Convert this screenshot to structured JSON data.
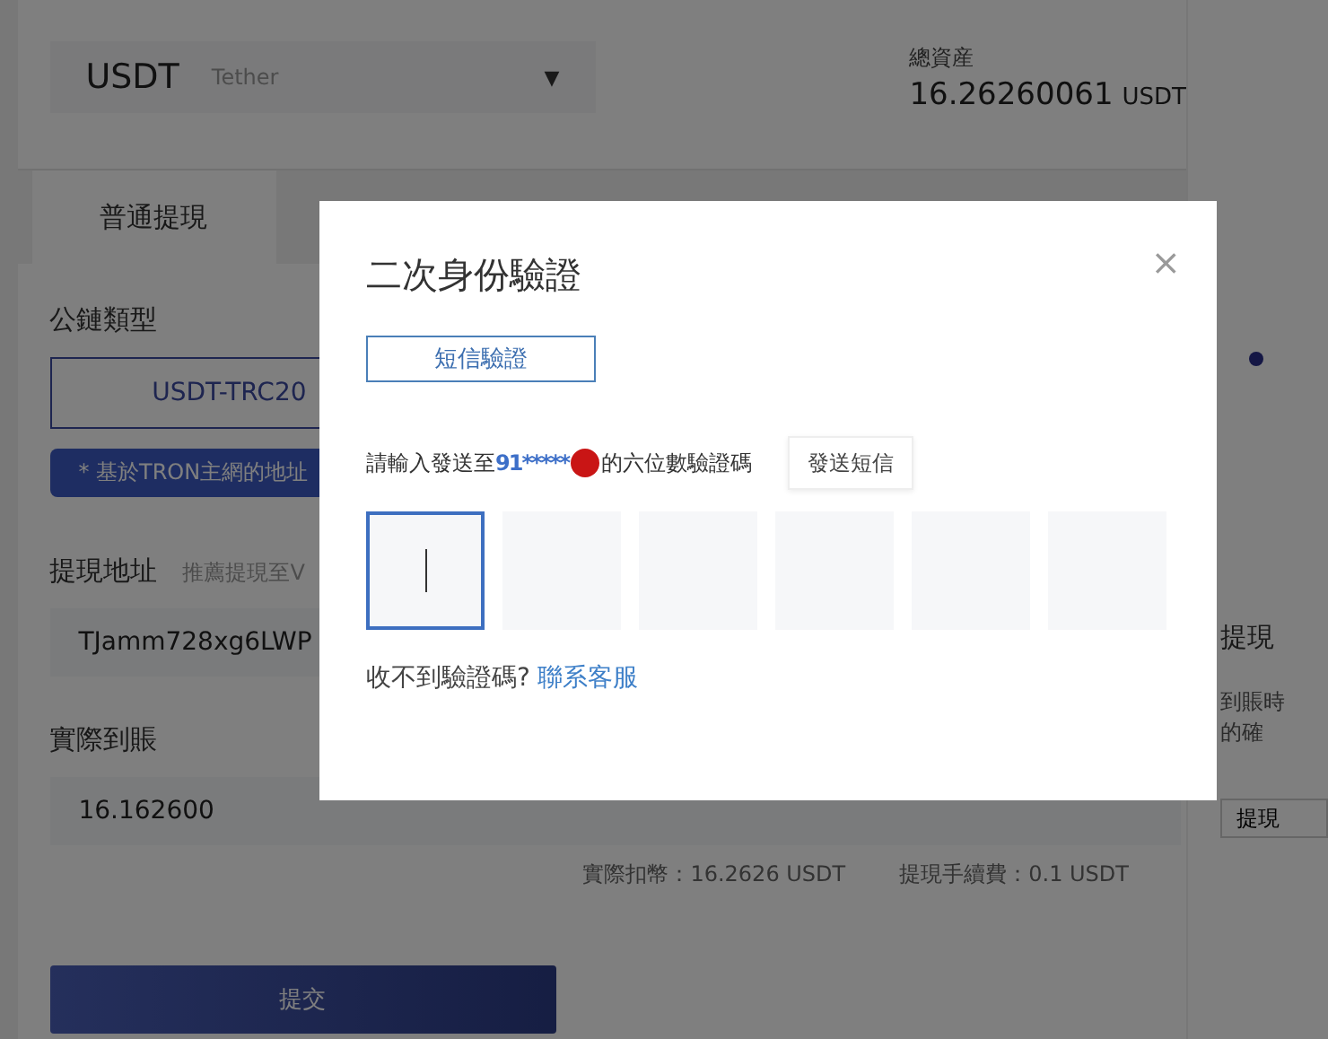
{
  "page": {
    "currency": {
      "code": "USDT",
      "name": "Tether",
      "caret": "▼"
    },
    "total_assets": {
      "label": "總資産",
      "amount": "16.26260061",
      "unit": "USDT"
    },
    "tabs": [
      {
        "label": "普通提現",
        "selected": true
      }
    ],
    "chain_label": "公鏈類型",
    "chains": [
      {
        "label": "USDT-TRC20",
        "selected": true
      }
    ],
    "chain_note": "* 基於TRON主網的地址",
    "address_label": "提現地址",
    "address_hint": "推薦提現至V",
    "address_value": "TJamm728xg6LWP",
    "received_label": "實際到賬",
    "received_value": "16.162600",
    "deducted": "實際扣幣：16.2626 USDT",
    "fee": "提現手續費：0.1 USDT",
    "submit": "提交",
    "side": {
      "heading": "提現",
      "lines": [
        "到賬時",
        "的確"
      ],
      "button": "提現"
    }
  },
  "dialog": {
    "title": "二次身份驗證",
    "close": "×",
    "methods": [
      {
        "label": "短信驗證",
        "selected": true
      }
    ],
    "prompt_before": "請輸入發送至",
    "phone": "91*****",
    "prompt_after": "的六位數驗證碼",
    "send_button": "發送短信",
    "code_boxes": [
      {
        "focused": true
      },
      {
        "focused": false
      },
      {
        "focused": false
      },
      {
        "focused": false
      },
      {
        "focused": false
      },
      {
        "focused": false
      }
    ],
    "help_text": "收不到驗證碼?",
    "help_link": "聯系客服"
  }
}
